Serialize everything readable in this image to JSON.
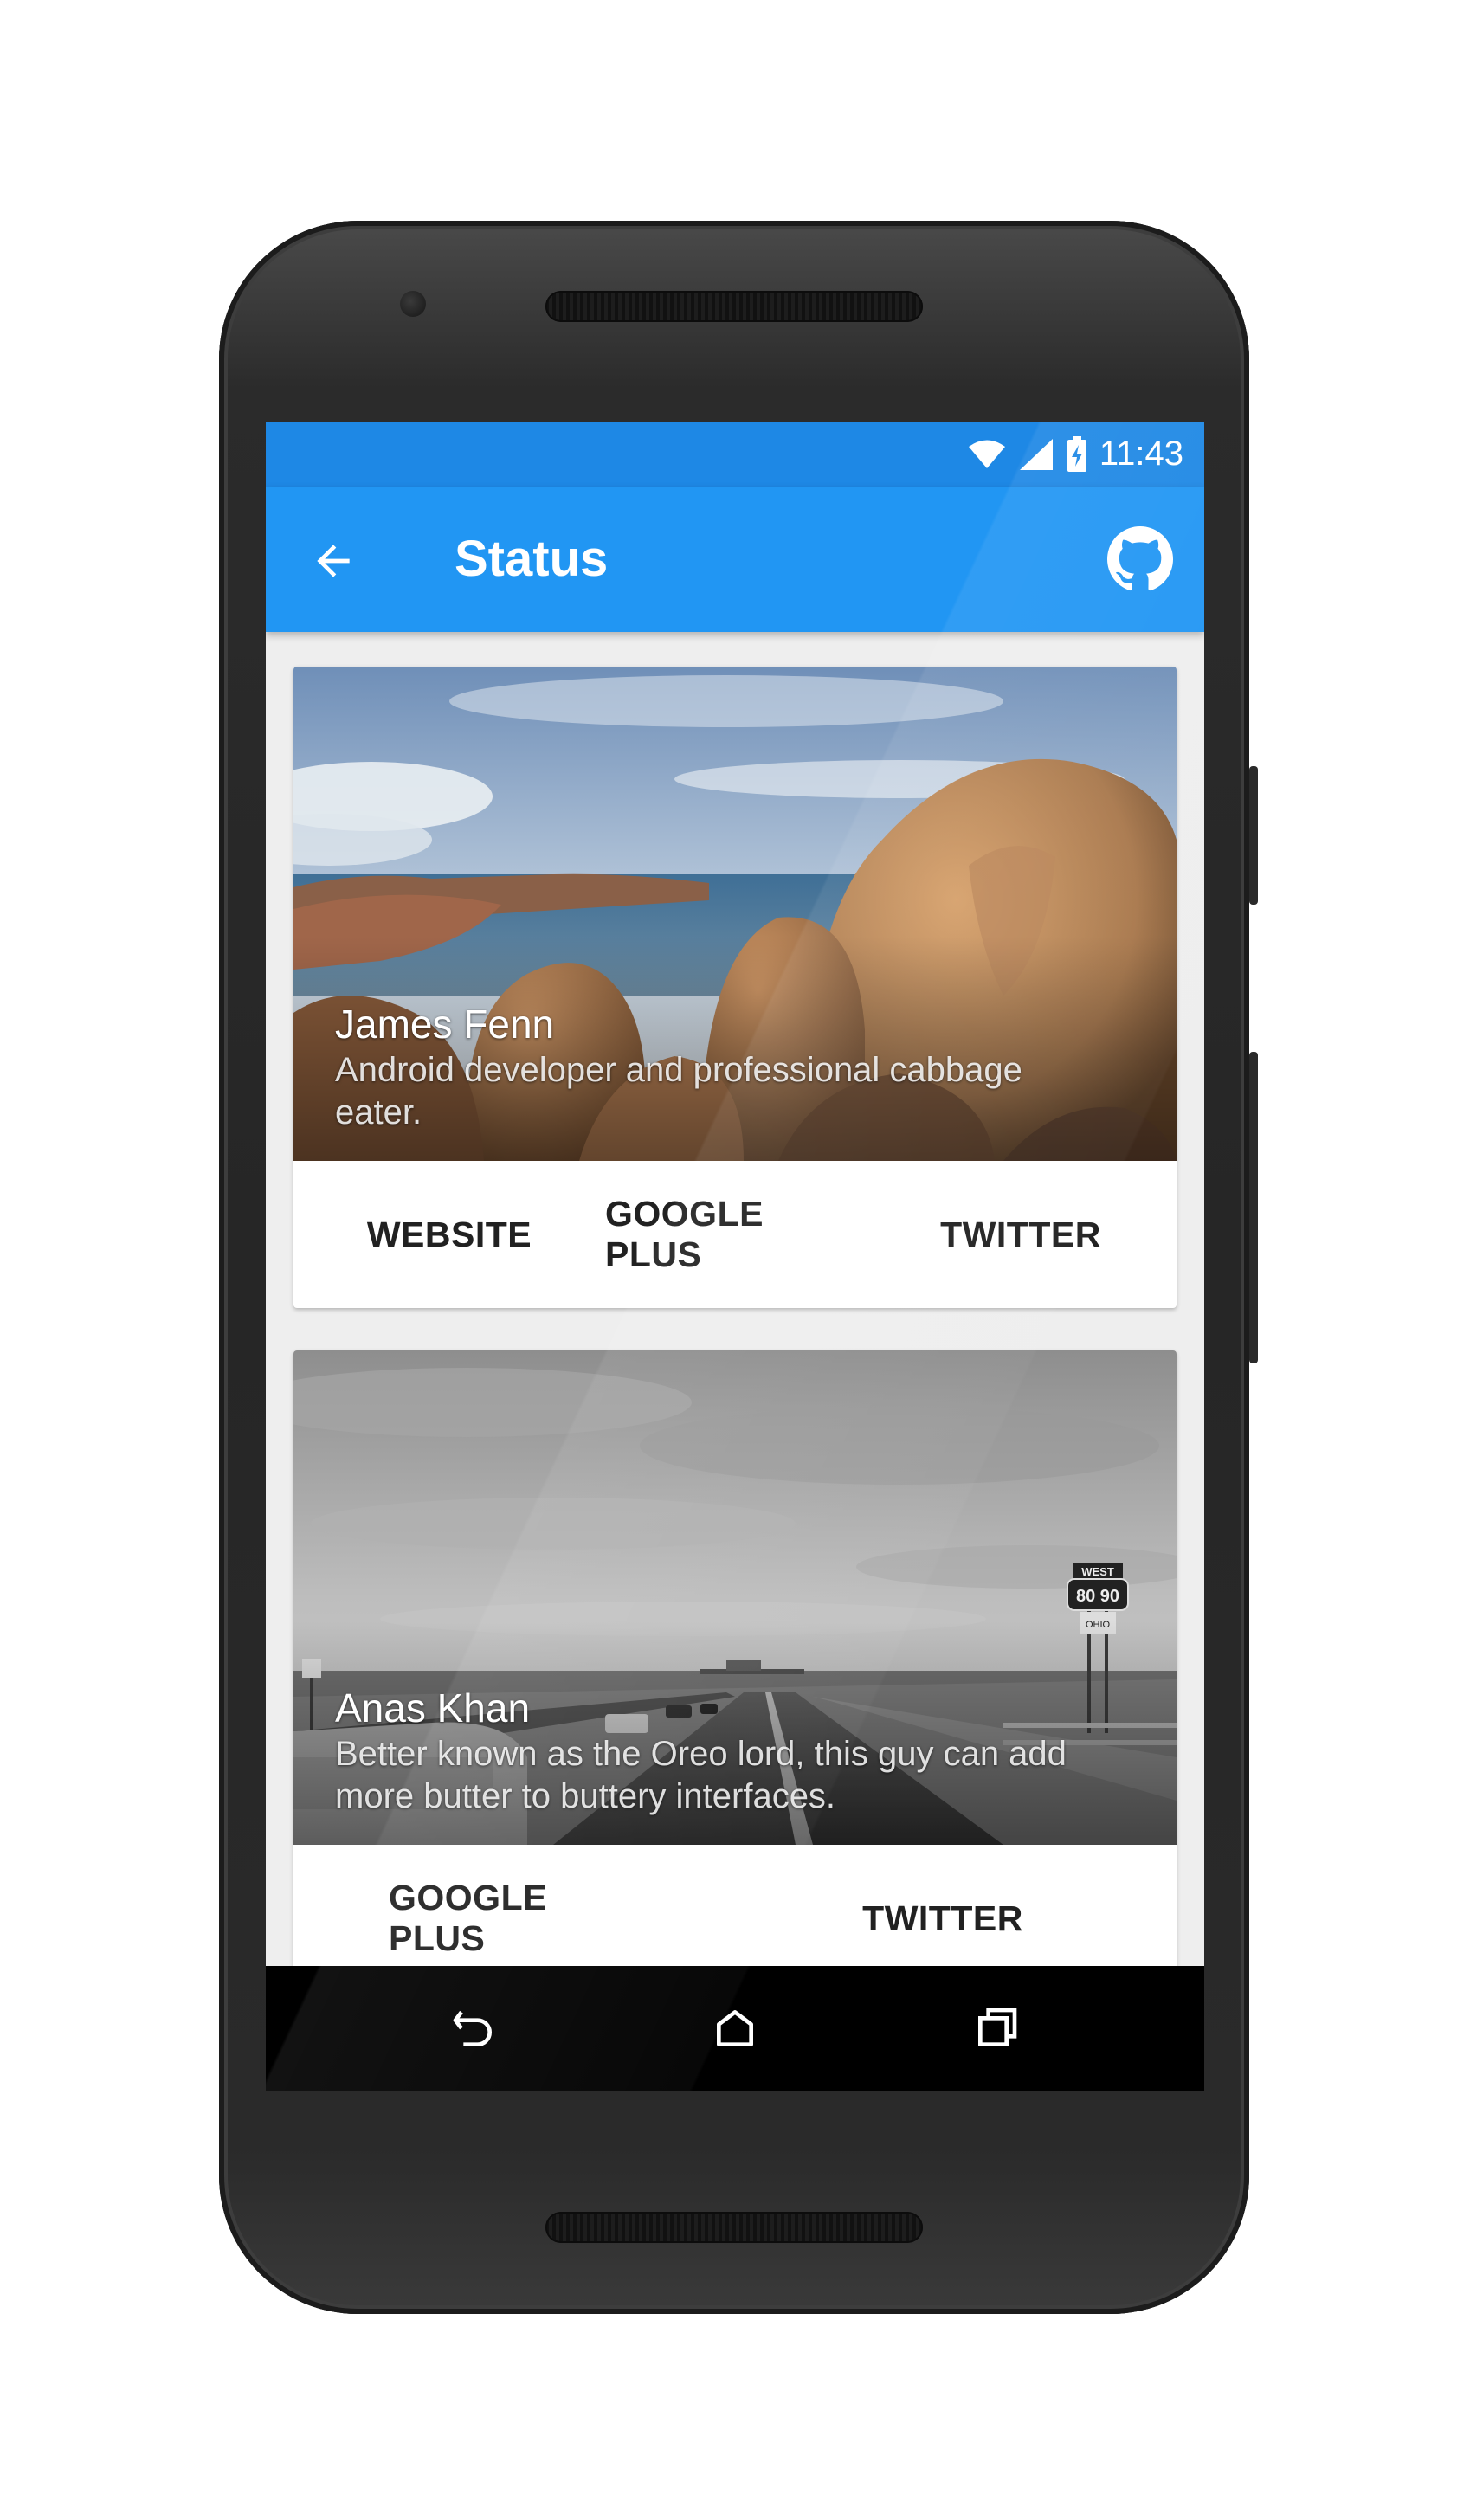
{
  "status_bar": {
    "time": "11:43"
  },
  "app_bar": {
    "title": "Status"
  },
  "cards": [
    {
      "name": "James Fenn",
      "description": "Android developer and professional cabbage eater.",
      "buttons": [
        "WEBSITE",
        "GOOGLE PLUS",
        "TWITTER"
      ]
    },
    {
      "name": "Anas Khan",
      "description": "Better known as the Oreo lord, this guy can add more butter to buttery interfaces.",
      "buttons": [
        "GOOGLE PLUS",
        "TWITTER"
      ]
    }
  ],
  "road_sign": {
    "direction": "WEST",
    "routes": "80 90",
    "state": "OHIO"
  },
  "icons": [
    "back-arrow-icon",
    "github-icon",
    "wifi-icon",
    "signal-icon",
    "battery-charging-icon",
    "nav-back-icon",
    "nav-home-icon",
    "nav-recents-icon"
  ],
  "colors": {
    "status_bar": "#1e88e5",
    "app_bar": "#2196f3",
    "background": "#eeeeee",
    "nav_bar": "#000000"
  }
}
